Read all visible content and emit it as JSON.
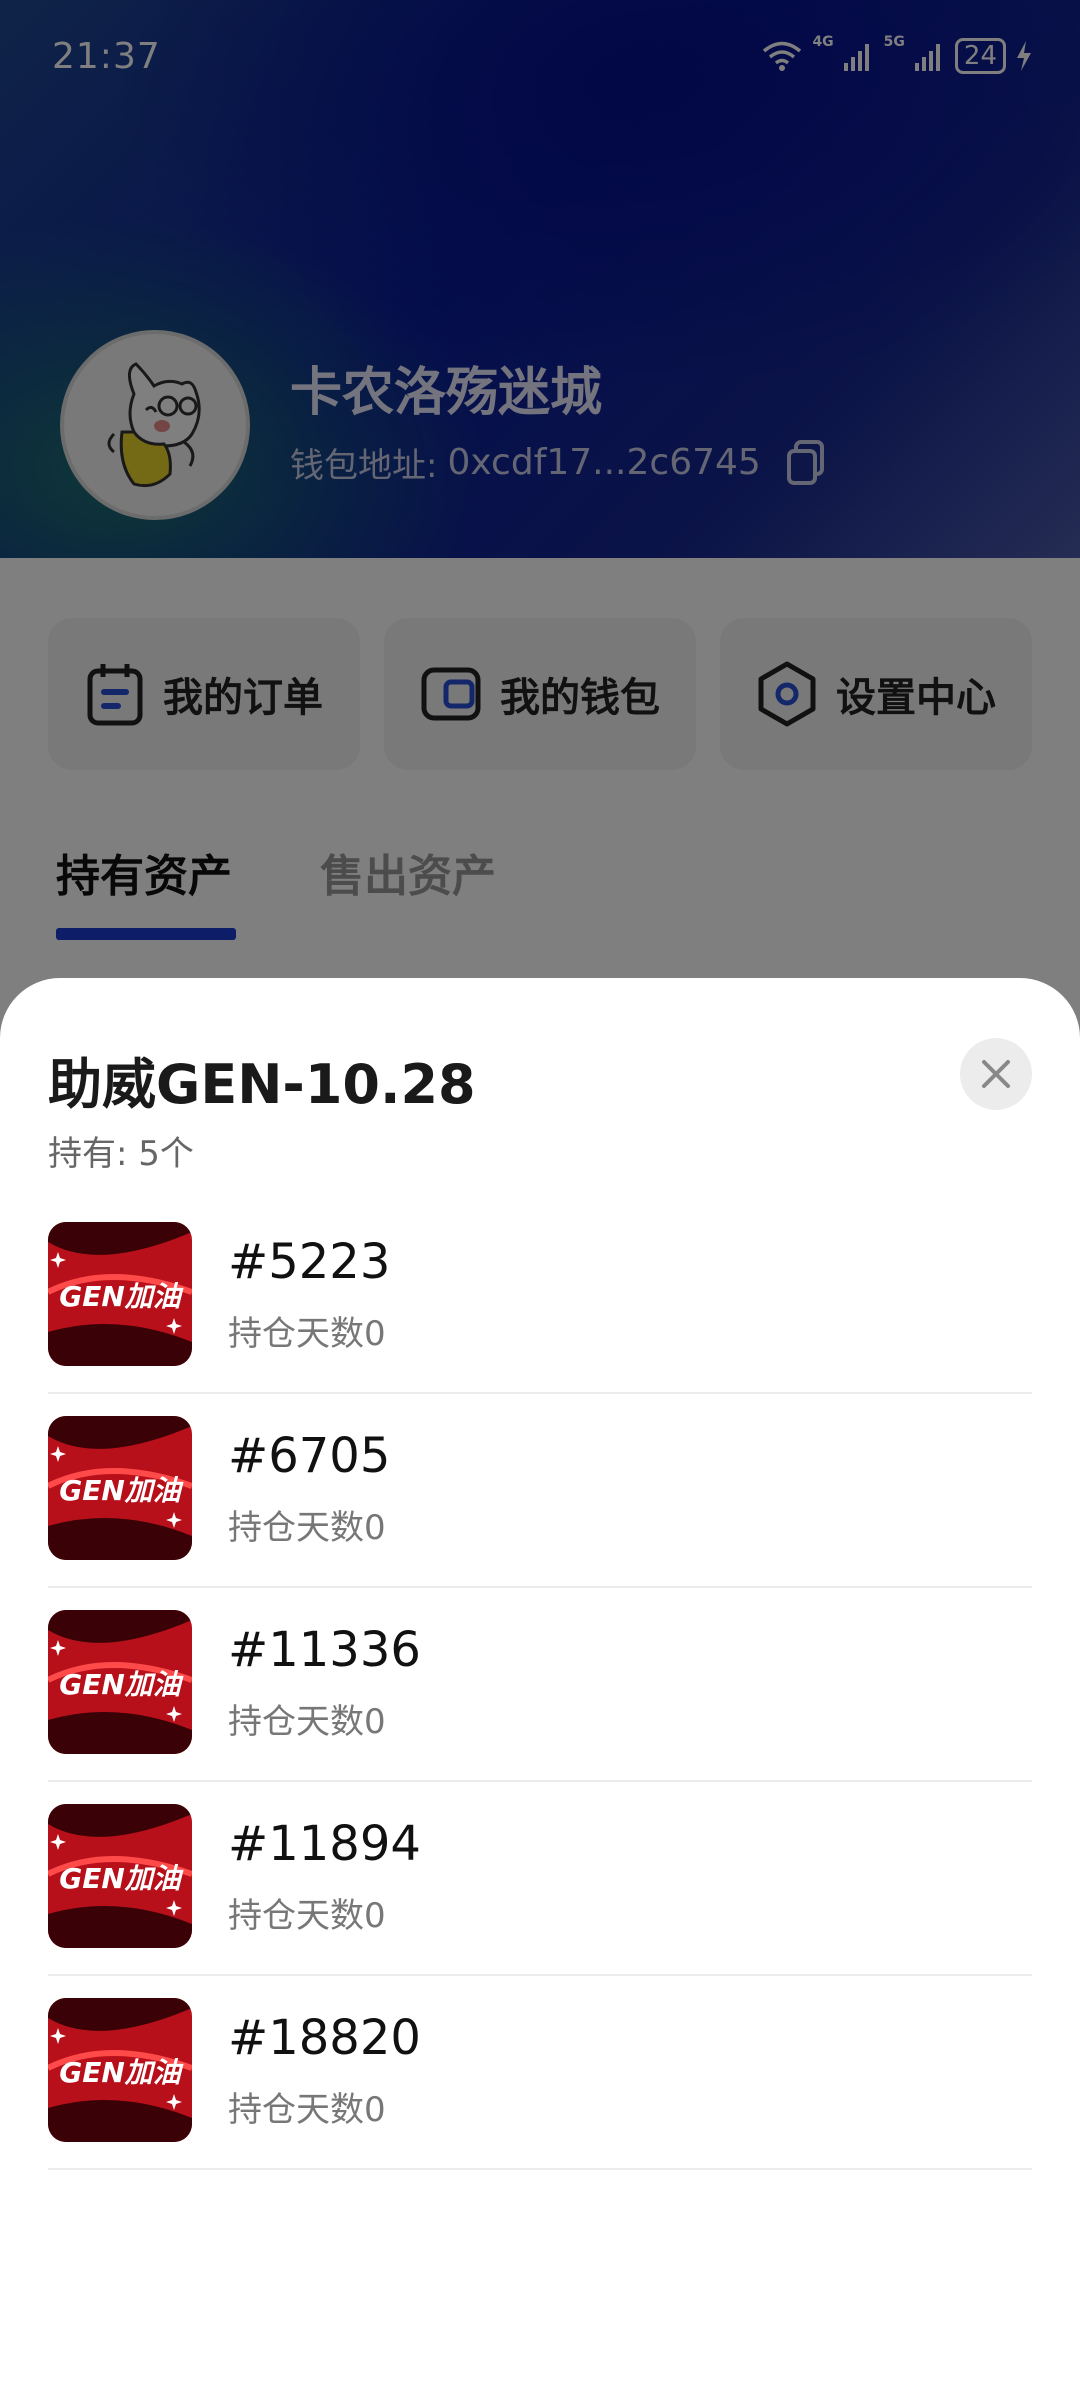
{
  "status_bar": {
    "time": "21:37",
    "network_1": "4G",
    "network_2": "5G",
    "battery": "24"
  },
  "profile": {
    "username": "卡农洛殇迷城",
    "wallet_label": "钱包地址:",
    "wallet_address": "0xcdf17...2c6745"
  },
  "quick_actions": [
    {
      "label": "我的订单",
      "icon": "orders-icon"
    },
    {
      "label": "我的钱包",
      "icon": "wallet-icon"
    },
    {
      "label": "设置中心",
      "icon": "settings-icon"
    }
  ],
  "tabs": [
    {
      "label": "持有资产",
      "active": true
    },
    {
      "label": "售出资产",
      "active": false
    }
  ],
  "sheet": {
    "title": "助威GEN-10.28",
    "subtitle": "持有: 5个",
    "thumb_text": "GEN加油",
    "items": [
      {
        "id": "#5223",
        "days": "持仓天数0"
      },
      {
        "id": "#6705",
        "days": "持仓天数0"
      },
      {
        "id": "#11336",
        "days": "持仓天数0"
      },
      {
        "id": "#11894",
        "days": "持仓天数0"
      },
      {
        "id": "#18820",
        "days": "持仓天数0"
      }
    ]
  },
  "colors": {
    "accent": "#1a3ad1",
    "tab_inactive": "#999999",
    "thumb_red": "#c8101a"
  }
}
